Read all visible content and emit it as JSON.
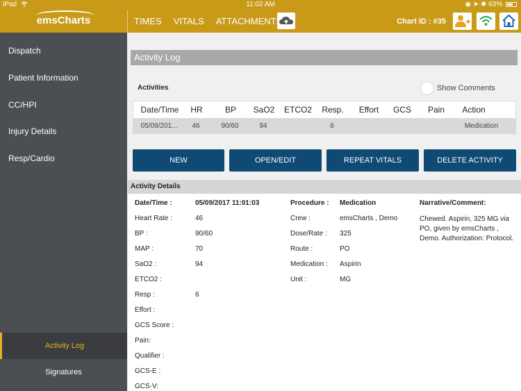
{
  "status_bar": {
    "device": "iPad",
    "time": "11:02 AM",
    "battery": "63%"
  },
  "header": {
    "logo": "emsCharts",
    "tabs": [
      "TIMES",
      "VITALS",
      "ATTACHMENTS"
    ],
    "chart_id": "Chart ID : #35",
    "accent_color": "#c89a18"
  },
  "sidebar": {
    "items": [
      "Dispatch",
      "Patient Information",
      "CC/HPI",
      "Injury Details",
      "Resp/Cardio"
    ],
    "bottom_items": [
      {
        "label": "Activity Log",
        "active": true
      },
      {
        "label": "Signatures",
        "active": false
      }
    ]
  },
  "main": {
    "section_title": "Activity Log",
    "activities_label": "Activities",
    "show_comments_label": "Show Comments",
    "table": {
      "columns": [
        "Date/Time",
        "HR",
        "BP",
        "SaO2",
        "ETCO2",
        "Resp.",
        "Effort",
        "GCS",
        "Pain",
        "Action"
      ],
      "rows": [
        [
          "05/09/201...",
          "46",
          "90/60",
          "94",
          "",
          "6",
          "",
          "",
          "",
          "Medication"
        ]
      ]
    },
    "buttons": [
      "NEW",
      "OPEN/EDIT",
      "REPEAT VITALS",
      "DELETE ACTIVITY"
    ],
    "button_color": "#0e4a73",
    "details_title": "Activity Details",
    "details": {
      "date_time_label": "Date/Time :",
      "date_time_value": "05/09/2017 11:01:03",
      "left": [
        {
          "label": "Heart Rate :",
          "value": "46"
        },
        {
          "label": "BP :",
          "value": "90/60"
        },
        {
          "label": "MAP :",
          "value": "70"
        },
        {
          "label": "SaO2 :",
          "value": "94"
        },
        {
          "label": "ETCO2 :",
          "value": ""
        },
        {
          "label": "Resp :",
          "value": "6"
        },
        {
          "label": "Effort :",
          "value": ""
        },
        {
          "label": "GCS Score :",
          "value": ""
        },
        {
          "label": "Pain:",
          "value": ""
        },
        {
          "label": "Qualifier :",
          "value": ""
        },
        {
          "label": "GCS-E :",
          "value": ""
        },
        {
          "label": "GCS-V:",
          "value": ""
        }
      ],
      "procedure_label": "Procedure :",
      "procedure_value": "Medication",
      "middle": [
        {
          "label": "Crew :",
          "value": "emsCharts , Demo"
        },
        {
          "label": "Dose/Rate :",
          "value": "325"
        },
        {
          "label": "Route :",
          "value": "PO"
        },
        {
          "label": "Medication :",
          "value": "Aspirin"
        },
        {
          "label": "Unit :",
          "value": "MG"
        }
      ],
      "narrative_label": "Narrative/Comment:",
      "narrative_text": "Chewed. Aspirin, 325 MG via PO, given by emsCharts , Demo. Authorization: Protocol."
    }
  }
}
